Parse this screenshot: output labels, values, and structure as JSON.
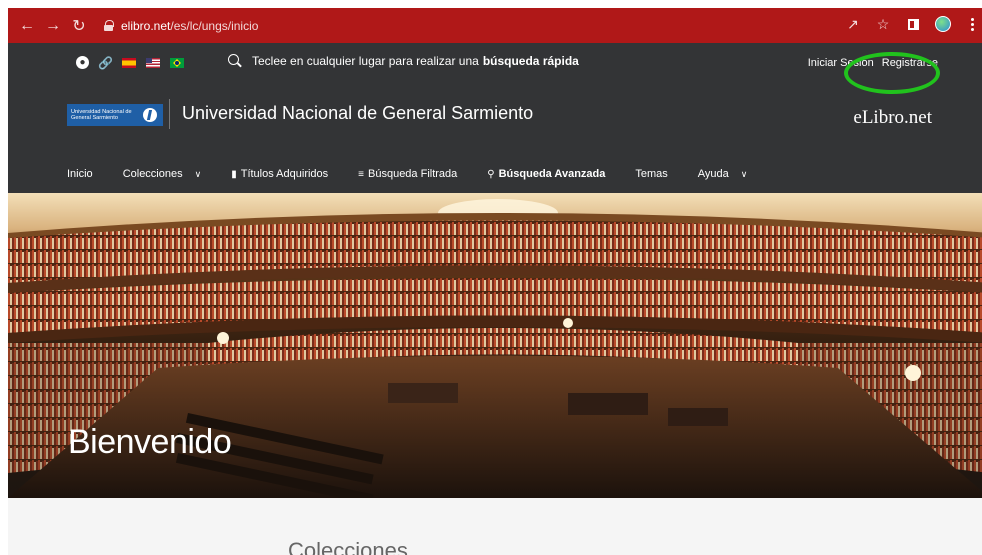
{
  "browser": {
    "url_host": "elibro.net",
    "url_path": "/es/lc/ungs/inicio",
    "back_icon": "arrow-left-icon",
    "forward_icon": "arrow-right-icon",
    "reload_icon": "reload-icon",
    "accent_color": "#b01818"
  },
  "topbar": {
    "search_text": "Teclee en cualquier lugar para realizar una",
    "search_bold": "búsqueda rápida",
    "login_label": "Iniciar Sesión",
    "register_label": "Registrarse"
  },
  "brand": {
    "logo_text": "Universidad Nacional de General Sarmiento",
    "university_name": "Universidad Nacional de General Sarmiento",
    "site_name": "eLibro.net"
  },
  "nav": {
    "items": [
      {
        "label": "Inicio"
      },
      {
        "label": "Colecciones"
      },
      {
        "label": "Títulos Adquiridos"
      },
      {
        "label": "Búsqueda Filtrada"
      },
      {
        "label": "Búsqueda Avanzada"
      },
      {
        "label": "Temas"
      },
      {
        "label": "Ayuda"
      }
    ]
  },
  "hero": {
    "title": "Bienvenido"
  },
  "content": {
    "section_title": "Colecciones"
  },
  "colors": {
    "header_bg": "#333436",
    "highlight_ring": "#21c21d"
  }
}
